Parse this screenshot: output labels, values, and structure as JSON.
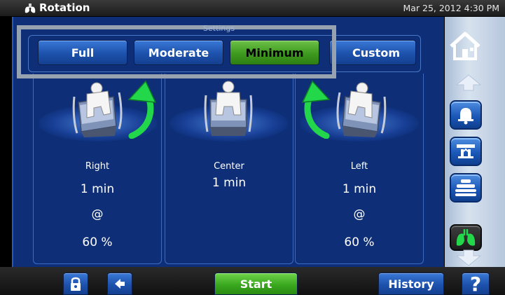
{
  "header": {
    "title": "Rotation",
    "datetime": "Mar 25, 2012 4:30 PM"
  },
  "settings": {
    "label": "Settings",
    "modes": [
      {
        "label": "Full",
        "active": false
      },
      {
        "label": "Moderate",
        "active": false
      },
      {
        "label": "Minimum",
        "active": true
      },
      {
        "label": "Custom",
        "active": false
      }
    ]
  },
  "positions": [
    {
      "label": "Right",
      "time": "1 min",
      "at": "@",
      "percent": "60 %"
    },
    {
      "label": "Center",
      "time": "1 min"
    },
    {
      "label": "Left",
      "time": "1 min",
      "at": "@",
      "percent": "60 %"
    }
  ],
  "footer": {
    "start_label": "Start",
    "history_label": "History",
    "help_label": "?"
  },
  "sidebar": {
    "icons": [
      "home-icon",
      "scroll-up-arrow-icon",
      "bell-icon",
      "scale-icon",
      "patient-bed-icon",
      "lungs-therapy-icon",
      "scroll-down-arrow-icon"
    ]
  },
  "colors": {
    "panel_bg": "#0e2f78",
    "button_blue": "#1d52ac",
    "active_green": "#3d9a1f",
    "start_green": "#3aa81f",
    "arrow_green": "#22d84a",
    "settings_highlight": "#97a2b0",
    "rail_bg": "#c5d3e4"
  }
}
